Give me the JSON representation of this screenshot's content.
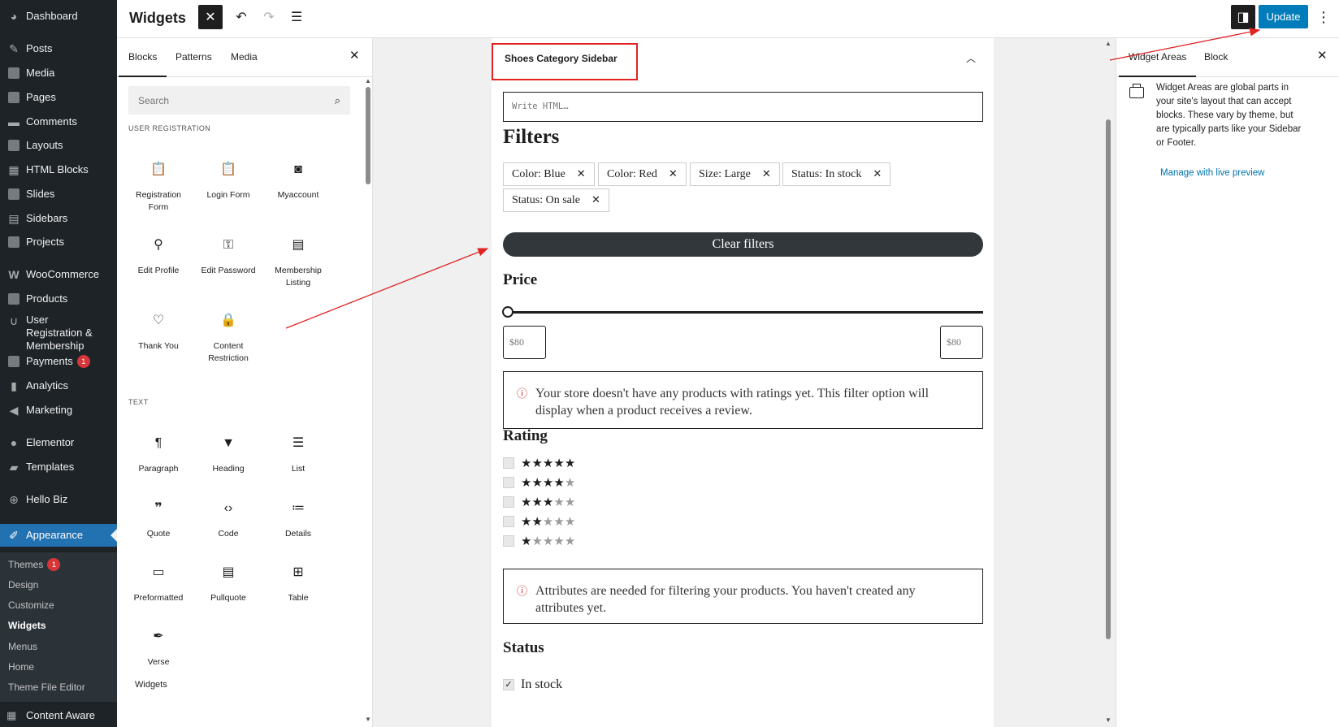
{
  "admin_menu": {
    "items": [
      {
        "label": "Dashboard"
      },
      {
        "label": "Posts"
      },
      {
        "label": "Media"
      },
      {
        "label": "Pages"
      },
      {
        "label": "Comments"
      },
      {
        "label": "Layouts"
      },
      {
        "label": "HTML Blocks"
      },
      {
        "label": "Slides"
      },
      {
        "label": "Sidebars"
      },
      {
        "label": "Projects"
      },
      {
        "label": "WooCommerce"
      },
      {
        "label": "Products"
      },
      {
        "label": "User Registration & Membership"
      },
      {
        "label": "Payments",
        "badge": "1"
      },
      {
        "label": "Analytics"
      },
      {
        "label": "Marketing"
      },
      {
        "label": "Elementor"
      },
      {
        "label": "Templates"
      },
      {
        "label": "Hello Biz"
      },
      {
        "label": "Appearance"
      }
    ],
    "submenu": [
      {
        "label": "Themes",
        "badge": "1"
      },
      {
        "label": "Design"
      },
      {
        "label": "Customize"
      },
      {
        "label": "Widgets"
      },
      {
        "label": "Menus"
      },
      {
        "label": "Home"
      },
      {
        "label": "Theme File Editor"
      }
    ],
    "bottom": "Content Aware"
  },
  "topbar": {
    "title": "Widgets",
    "update_label": "Update"
  },
  "inserter": {
    "tabs": [
      "Blocks",
      "Patterns",
      "Media"
    ],
    "search_placeholder": "Search",
    "categories": {
      "user_registration": "USER REGISTRATION",
      "text": "TEXT",
      "widgets": "Widgets"
    },
    "ur_blocks": [
      [
        "Registration",
        "Form"
      ],
      [
        "Login Form"
      ],
      [
        "Myaccount"
      ],
      [
        "Edit Profile"
      ],
      [
        "Edit Password"
      ],
      [
        "Membership",
        "Listing"
      ],
      [
        "Thank You"
      ],
      [
        "Content",
        "Restriction"
      ]
    ],
    "text_blocks": [
      "Paragraph",
      "Heading",
      "List",
      "Quote",
      "Code",
      "Details",
      "Preformatted",
      "Pullquote",
      "Table",
      "Verse"
    ]
  },
  "canvas": {
    "area_title": "Shoes Category Sidebar",
    "html_placeholder": "Write HTML…",
    "filters_heading": "Filters",
    "chips": [
      "Color: Blue",
      "Color: Red",
      "Size: Large",
      "Status: In stock",
      "Status: On sale"
    ],
    "clear_label": "Clear filters",
    "price_heading": "Price",
    "price_min": "$80",
    "price_max": "$80",
    "rating_notice_1": "Your store doesn't have any products with ratings yet. This filter option will",
    "rating_notice_2": "display when a product receives a review.",
    "rating_heading": "Rating",
    "ratings": [
      5,
      4,
      3,
      2,
      1
    ],
    "attr_notice_1": "Attributes are needed for filtering your products. You haven't created any",
    "attr_notice_2": "attributes yet.",
    "status_heading": "Status",
    "status_option": "In stock"
  },
  "settings": {
    "tabs": [
      "Widget Areas",
      "Block"
    ],
    "description_lines": [
      "Widget Areas are global parts in",
      "your site's layout that can accept",
      "blocks. These vary by theme, but",
      "are typically parts like your Sidebar",
      "or Footer."
    ],
    "link_label": "Manage with live preview"
  },
  "colors": {
    "admin_bg": "#1d2327",
    "accent": "#2271b1",
    "update": "#007cba",
    "highlight": "#e02222"
  }
}
